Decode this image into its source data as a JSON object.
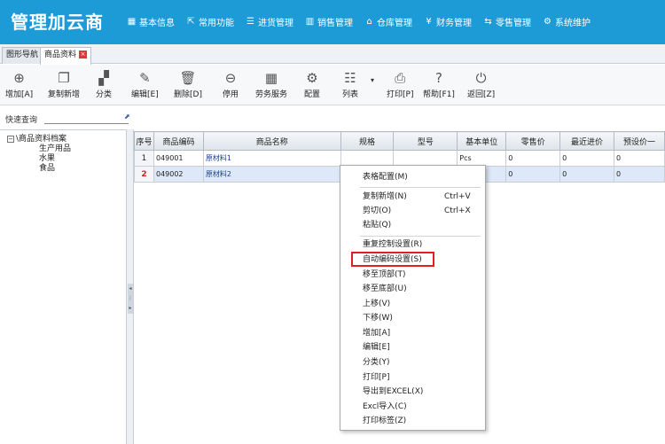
{
  "app": {
    "title": "管理加云商"
  },
  "topnav": [
    {
      "label": "基本信息",
      "icon": "grid-icon"
    },
    {
      "label": "常用功能",
      "icon": "external-link-icon"
    },
    {
      "label": "进货管理",
      "icon": "list-icon"
    },
    {
      "label": "销售管理",
      "icon": "bar-chart-icon"
    },
    {
      "label": "仓库管理",
      "icon": "home-icon"
    },
    {
      "label": "财务管理",
      "icon": "yen-icon"
    },
    {
      "label": "零售管理",
      "icon": "exchange-icon"
    },
    {
      "label": "系统维护",
      "icon": "gear-icon"
    }
  ],
  "tabs": [
    {
      "label": "图形导航"
    },
    {
      "label": "商品资料",
      "close": "×"
    }
  ],
  "toolbar": [
    {
      "label": "增加[A]",
      "icon": "plus-circle-icon"
    },
    {
      "label": "复制新增",
      "icon": "copy-icon"
    },
    {
      "label": "分类",
      "icon": "category-icon"
    },
    {
      "label": "编辑[E]",
      "icon": "edit-icon"
    },
    {
      "label": "删除[D]",
      "icon": "trash-icon"
    },
    {
      "label": "停用",
      "icon": "minus-circle-icon"
    },
    {
      "label": "劳务服务",
      "icon": "service-icon"
    },
    {
      "label": "配置",
      "icon": "gear-icon"
    },
    {
      "label": "列表",
      "icon": "list-view-icon"
    },
    {
      "label": "打印[P]",
      "icon": "printer-icon"
    },
    {
      "label": "帮助[F1]",
      "icon": "help-icon"
    },
    {
      "label": "返回[Z]",
      "icon": "power-icon"
    }
  ],
  "quick_search": {
    "label": "快速查询"
  },
  "tree": {
    "root": "\\商品资料档案",
    "root_toggle": "−",
    "children": [
      "生产用品",
      "水果",
      "食品"
    ]
  },
  "grid": {
    "headers": [
      "序号",
      "商品编码",
      "商品名称",
      "规格",
      "型号",
      "基本单位",
      "零售价",
      "最近进价",
      "预设价一"
    ],
    "rows": [
      [
        "1",
        "049001",
        "原材料1",
        "",
        "",
        "Pcs",
        "0",
        "0",
        "0"
      ],
      [
        "2",
        "049002",
        "原材料2",
        "",
        "",
        "",
        "0",
        "0",
        "0"
      ]
    ],
    "selected_row": 1
  },
  "context_menu": {
    "items": [
      {
        "label": "表格配置(M)",
        "shortcut": ""
      },
      {
        "label": "复制新增(N)",
        "shortcut": "Ctrl+V"
      },
      {
        "label": "剪切(O)",
        "shortcut": "Ctrl+X"
      },
      {
        "label": "粘贴(Q)",
        "shortcut": ""
      },
      {
        "label": "重复控制设置(R)",
        "shortcut": ""
      },
      {
        "label": "自动编码设置(S)",
        "shortcut": ""
      },
      {
        "label": "移至顶部(T)",
        "shortcut": ""
      },
      {
        "label": "移至底部(U)",
        "shortcut": ""
      },
      {
        "label": "上移(V)",
        "shortcut": ""
      },
      {
        "label": "下移(W)",
        "shortcut": ""
      },
      {
        "label": "增加[A]",
        "shortcut": ""
      },
      {
        "label": "编辑[E]",
        "shortcut": ""
      },
      {
        "label": "分类(Y)",
        "shortcut": ""
      },
      {
        "label": "打印[P]",
        "shortcut": ""
      },
      {
        "label": "导出到EXCEL(X)",
        "shortcut": ""
      },
      {
        "label": "Excl导入(C)",
        "shortcut": ""
      },
      {
        "label": "打印标签(Z)",
        "shortcut": ""
      }
    ],
    "highlighted": "自动编码设置(S)"
  },
  "colors": {
    "header_bg": "#1c9bd7",
    "highlight_border": "#e02020",
    "selected_row_bg": "#dde9f8"
  }
}
